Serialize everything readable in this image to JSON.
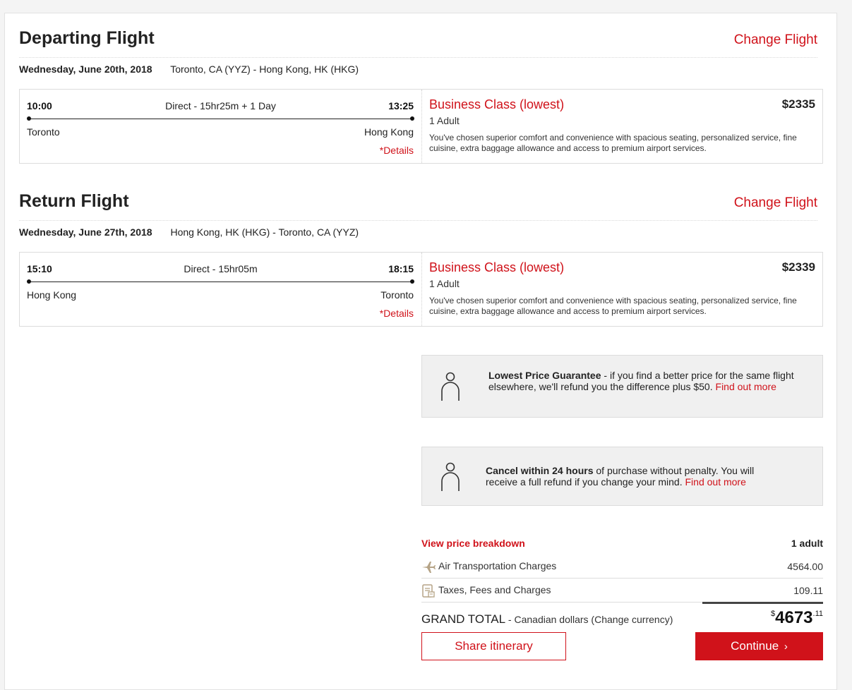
{
  "departing": {
    "title": "Departing Flight",
    "change_label": "Change Flight",
    "date": "Wednesday, June 20th, 2018",
    "route": "Toronto, CA (YYZ) - Hong Kong, HK (HKG)",
    "dep_time": "10:00",
    "arr_time": "13:25",
    "duration": "Direct - 15hr25m + 1 Day",
    "dep_city": "Toronto",
    "arr_city": "Hong Kong",
    "details_label": "*Details",
    "fare_class": "Business Class (lowest)",
    "passengers": "1 Adult",
    "price": "$2335",
    "description": "You've chosen superior comfort and convenience with spacious seating, personalized service, fine cuisine, extra baggage allowance and access to premium airport services."
  },
  "return": {
    "title": "Return Flight",
    "change_label": "Change Flight",
    "date": "Wednesday, June 27th, 2018",
    "route": "Hong Kong, HK (HKG) - Toronto, CA (YYZ)",
    "dep_time": "15:10",
    "arr_time": "18:15",
    "duration": "Direct - 15hr05m",
    "dep_city": "Hong Kong",
    "arr_city": "Toronto",
    "details_label": "*Details",
    "fare_class": "Business Class (lowest)",
    "passengers": "1 Adult",
    "price": "$2339",
    "description": "You've chosen superior comfort and convenience with spacious seating, personalized service, fine cuisine, extra baggage allowance and access to premium airport services."
  },
  "guarantee": {
    "title": "Lowest Price Guarantee",
    "text": " - if you find a better price for the same flight elsewhere, we'll refund you the difference plus $50. ",
    "link": "Find out more"
  },
  "cancel": {
    "title": "Cancel within 24 hours",
    "text": " of purchase without penalty. You will receive a full refund if you change your mind. ",
    "link": "Find out more"
  },
  "breakdown": {
    "link": "View price breakdown",
    "column": "1 adult",
    "rows": [
      {
        "label": "Air Transportation Charges",
        "value": "4564.00",
        "icon": "airplane-icon"
      },
      {
        "label": "Taxes, Fees and Charges",
        "value": "109.11",
        "icon": "receipt-icon"
      }
    ]
  },
  "total": {
    "label": "GRAND TOTAL",
    "currency_prefix": " - Canadian dollars (",
    "change_currency": "Change currency",
    "currency_suffix": ")",
    "symbol": "$",
    "amount": "4673",
    "cents": ".11"
  },
  "actions": {
    "share": "Share itinerary",
    "continue": "Continue"
  },
  "colors": {
    "accent": "#d0121a",
    "info_bg": "#f0f0f0"
  }
}
